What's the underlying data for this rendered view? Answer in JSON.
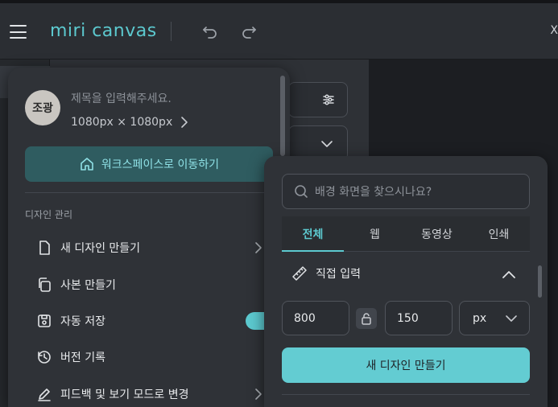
{
  "topbar": {
    "logo_text": "miri canvas",
    "right_label": "X"
  },
  "menu": {
    "avatar_text": "조광",
    "title_placeholder": "제목을 입력해주세요.",
    "size_text": "1080px × 1080px",
    "workspace_button": "워크스페이스로 이동하기",
    "section_label": "디자인 관리",
    "items": [
      {
        "label": "새 디자인 만들기",
        "icon": "file-icon",
        "has_chevron": true
      },
      {
        "label": "사본 만들기",
        "icon": "copy-icon"
      },
      {
        "label": "자동 저장",
        "icon": "save-icon",
        "toggle": true,
        "toggle_on": true
      },
      {
        "label": "버전 기록",
        "icon": "history-icon"
      },
      {
        "label": "피드백 및 보기 모드로 변경",
        "icon": "pencil-icon",
        "has_chevron": true
      }
    ]
  },
  "panel": {
    "search_placeholder": "배경 화면을 찾으시나요?",
    "tabs": [
      {
        "label": "전체",
        "active": true
      },
      {
        "label": "웹",
        "active": false
      },
      {
        "label": "동영상",
        "active": false
      },
      {
        "label": "인쇄",
        "active": false
      }
    ],
    "direct_input_label": "직접 입력",
    "width_value": "800",
    "height_value": "150",
    "unit_value": "px",
    "create_button": "새 디자인 만들기"
  },
  "colors": {
    "accent": "#5cc9cf",
    "topbar_bg": "#2b2e33",
    "panel_bg": "#2f3237",
    "workspace_button_bg": "#2f5c60"
  }
}
